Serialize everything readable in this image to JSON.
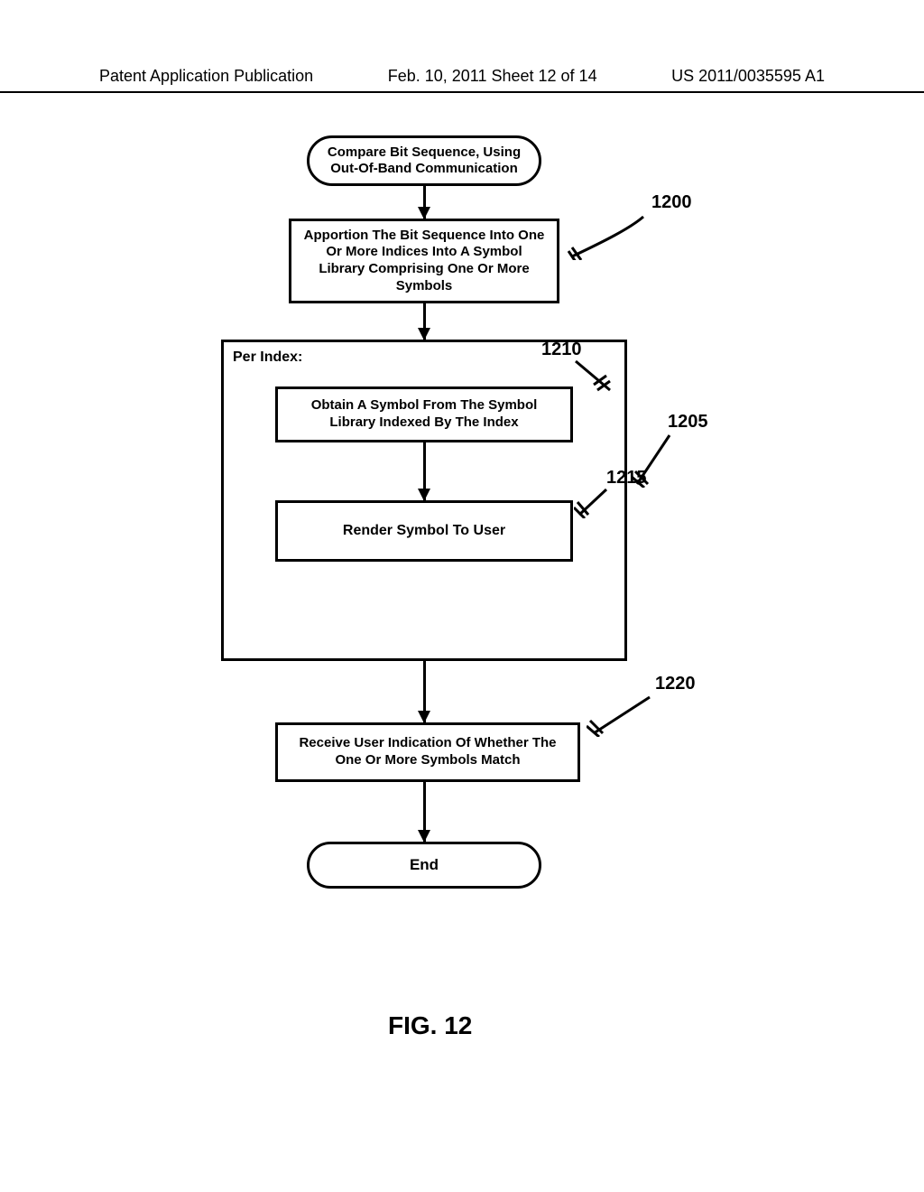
{
  "header": {
    "left": "Patent Application Publication",
    "center": "Feb. 10, 2011  Sheet 12 of 14",
    "right": "US 2011/0035595 A1"
  },
  "flowchart": {
    "start": "Compare Bit Sequence, Using Out-Of-Band Communication",
    "step_apportion": "Apportion The Bit Sequence Into One Or More Indices Into A Symbol Library Comprising One Or More Symbols",
    "per_index_label": "Per Index:",
    "step_obtain": "Obtain A Symbol From The Symbol Library Indexed By The Index",
    "step_render": "Render Symbol To User",
    "step_receive": "Receive User Indication Of Whether The One Or More Symbols Match",
    "end": "End"
  },
  "refs": {
    "r1200": "1200",
    "r1205": "1205",
    "r1210": "1210",
    "r1215": "1215",
    "r1220": "1220"
  },
  "figure_caption": "FIG. 12"
}
